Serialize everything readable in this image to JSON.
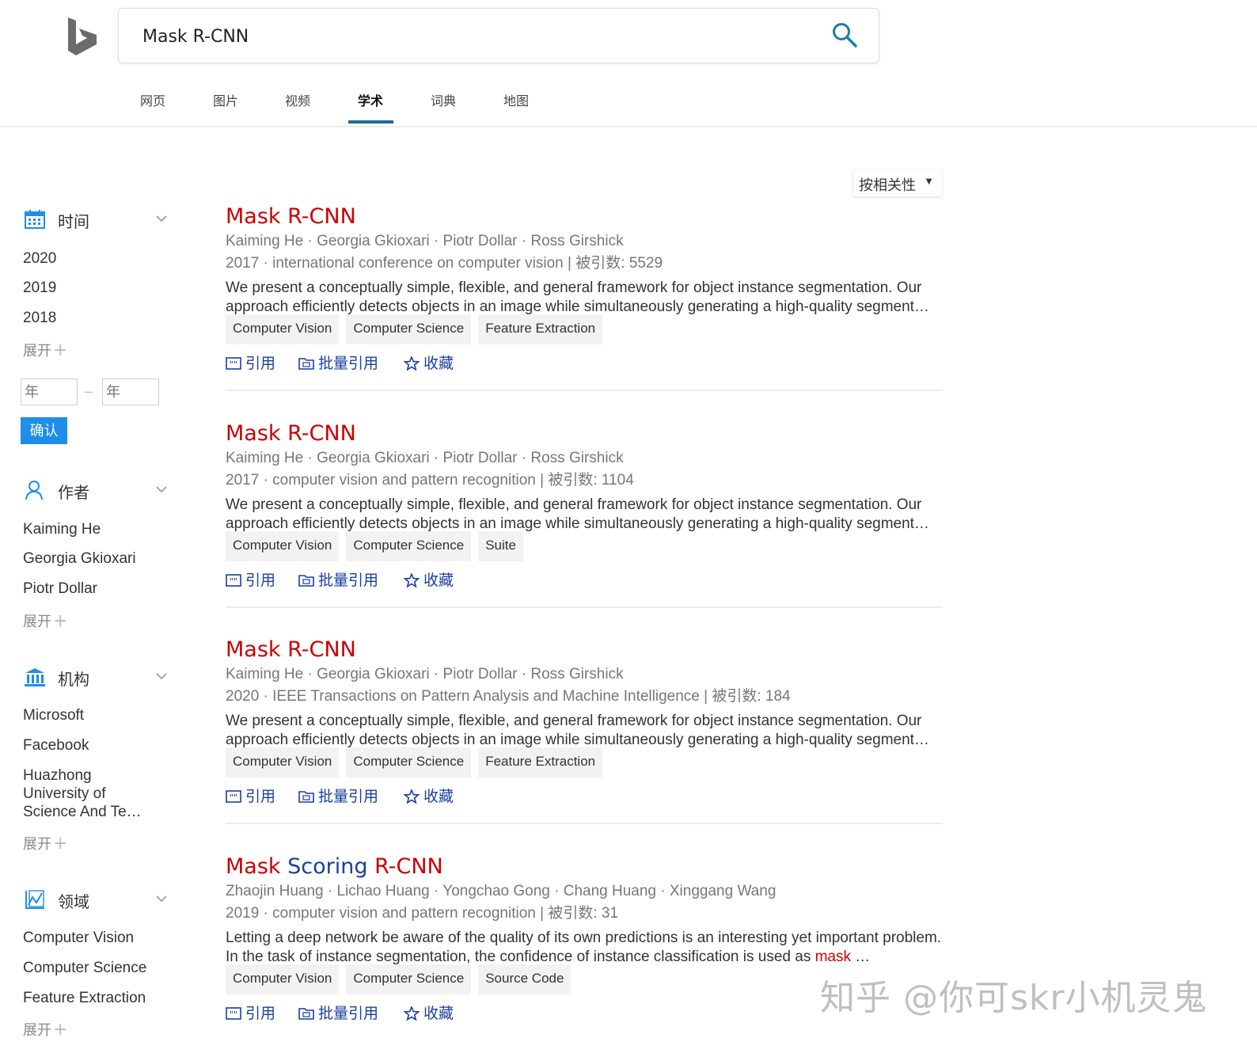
{
  "search": {
    "value": "Mask R-CNN"
  },
  "tabs": [
    {
      "label": "网页"
    },
    {
      "label": "图片"
    },
    {
      "label": "视频"
    },
    {
      "label": "学术"
    },
    {
      "label": "词典"
    },
    {
      "label": "地图"
    }
  ],
  "active_tab": "学术",
  "sort": {
    "label": "按相关性",
    "arrow": "▼"
  },
  "sidebar": {
    "time": {
      "title": "时间",
      "items": [
        "2020",
        "2019",
        "2018"
      ],
      "expand": "展开",
      "year_from_placeholder": "年",
      "year_to_placeholder": "年",
      "dash": "–",
      "confirm": "确认"
    },
    "author": {
      "title": "作者",
      "items": [
        "Kaiming He",
        "Georgia Gkioxari",
        "Piotr Dollar"
      ],
      "expand": "展开"
    },
    "org": {
      "title": "机构",
      "items": [
        "Microsoft",
        "Facebook",
        "Huazhong University of Science And Te…"
      ],
      "expand": "展开"
    },
    "field": {
      "title": "领域",
      "items": [
        "Computer Vision",
        "Computer Science",
        "Feature Extraction"
      ],
      "expand": "展开"
    },
    "plus": "+"
  },
  "actions": {
    "cite": "引用",
    "batch_cite": "批量引用",
    "favorite": "收藏"
  },
  "results": [
    {
      "title": "Mask R-CNN",
      "authors": "Kaiming He · Georgia Gkioxari · Piotr Dollar · Ross Girshick",
      "meta": "2017 · international conference on computer vision  |  被引数:  5529",
      "abstract": "We present a conceptually simple, flexible, and general framework for object instance segmentation. Our approach efficiently detects objects in an image while simultaneously generating a high-quality segment…",
      "tags": [
        "Computer Vision",
        "Computer Science",
        "Feature Extraction"
      ]
    },
    {
      "title": "Mask R-CNN",
      "authors": "Kaiming He · Georgia Gkioxari · Piotr Dollar · Ross Girshick",
      "meta": "2017 · computer vision and pattern recognition  |  被引数:  1104",
      "abstract": "We present a conceptually simple, flexible, and general framework for object instance segmentation. Our approach efficiently detects objects in an image while simultaneously generating a high-quality segment…",
      "tags": [
        "Computer Vision",
        "Computer Science",
        "Suite"
      ]
    },
    {
      "title": "Mask R-CNN",
      "authors": "Kaiming He · Georgia Gkioxari · Piotr Dollar · Ross Girshick",
      "meta": "2020 · IEEE Transactions on Pattern Analysis and Machine Intelligence  |  被引数:  184",
      "abstract": "We present a conceptually simple, flexible, and general framework for object instance segmentation. Our approach efficiently detects objects in an image while simultaneously generating a high-quality segment…",
      "tags": [
        "Computer Vision",
        "Computer Science",
        "Feature Extraction"
      ]
    },
    {
      "title_red_1": "Mask",
      "title_blue": "Scoring",
      "title_red_2": "R-CNN",
      "authors": "Zhaojin Huang · Lichao Huang · Yongchao Gong · Chang Huang · Xinggang Wang",
      "meta": "2019 · computer vision and pattern recognition  |  被引数:  31",
      "abstract_1": "Letting a deep network be aware of the quality of its own predictions is an interesting yet important problem. In the task of instance segmentation, the confidence of instance classification is used as",
      "abstract_hl": "mask",
      "abstract_2": "…",
      "tags": [
        "Computer Vision",
        "Computer Science",
        "Source Code"
      ]
    }
  ],
  "watermark": "知乎 @你可skr小机灵鬼",
  "colors": {
    "title_red": "#cc0000",
    "link_blue": "#1a3fa0",
    "accent_blue": "#1e8ee8",
    "tab_underline": "#1b6b9a"
  }
}
